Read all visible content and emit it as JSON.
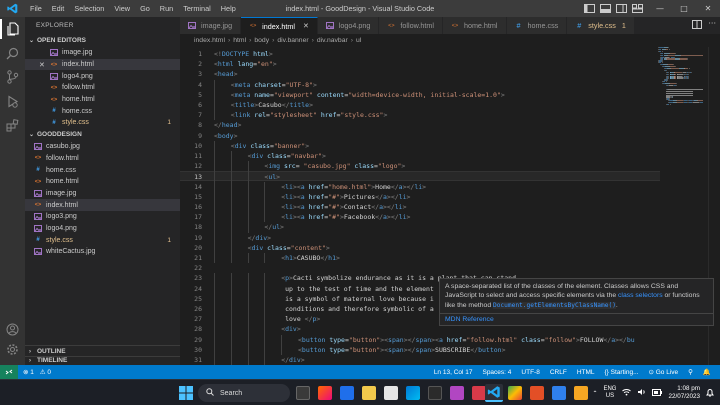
{
  "window": {
    "title": "index.html - GoodDesign - Visual Studio Code",
    "menu": [
      "File",
      "Edit",
      "Selection",
      "View",
      "Go",
      "Run",
      "Terminal",
      "Help"
    ]
  },
  "activity_bar": {
    "icons": [
      "explorer-icon",
      "search-icon",
      "source-control-icon",
      "run-debug-icon",
      "extensions-icon",
      "account-icon",
      "manage-gear-icon"
    ]
  },
  "sidebar": {
    "title": "EXPLORER",
    "open_editors": {
      "label": "OPEN EDITORS",
      "files": [
        {
          "name": "image.jpg",
          "icon": "image"
        },
        {
          "name": "index.html",
          "icon": "html",
          "close": "✕",
          "selected": true
        },
        {
          "name": "logo4.png",
          "icon": "image"
        },
        {
          "name": "follow.html",
          "icon": "html"
        },
        {
          "name": "home.html",
          "icon": "html"
        },
        {
          "name": "home.css",
          "icon": "css"
        },
        {
          "name": "style.css",
          "icon": "css",
          "modified": true,
          "count": "1"
        }
      ]
    },
    "folder": {
      "label": "GOODDESIGN",
      "files": [
        {
          "name": "casubo.jpg",
          "icon": "image"
        },
        {
          "name": "follow.html",
          "icon": "html"
        },
        {
          "name": "home.css",
          "icon": "css"
        },
        {
          "name": "home.html",
          "icon": "html"
        },
        {
          "name": "image.jpg",
          "icon": "image"
        },
        {
          "name": "index.html",
          "icon": "html",
          "selected": true
        },
        {
          "name": "logo3.png",
          "icon": "image"
        },
        {
          "name": "logo4.png",
          "icon": "image"
        },
        {
          "name": "style.css",
          "icon": "css",
          "modified": true,
          "count": "1"
        },
        {
          "name": "whiteCactus.jpg",
          "icon": "image"
        }
      ]
    },
    "outline_label": "OUTLINE",
    "timeline_label": "TIMELINE"
  },
  "tabs": [
    {
      "label": "image.jpg",
      "icon": "image"
    },
    {
      "label": "index.html",
      "icon": "html",
      "active": true,
      "close": "✕"
    },
    {
      "label": "logo4.png",
      "icon": "image"
    },
    {
      "label": "follow.html",
      "icon": "html"
    },
    {
      "label": "home.html",
      "icon": "html"
    },
    {
      "label": "home.css",
      "icon": "css"
    },
    {
      "label": "style.css",
      "icon": "css",
      "modified": true,
      "count": "1"
    }
  ],
  "breadcrumb": [
    "index.html",
    "html",
    "body",
    "div.banner",
    "div.navbar",
    "ul"
  ],
  "code": {
    "current_line": 13,
    "lines": [
      {
        "n": "1",
        "indent": 0,
        "t": [
          [
            "p",
            "<!"
          ],
          [
            "g",
            "DOCTYPE"
          ],
          [
            "a",
            " html"
          ],
          [
            "p",
            ">"
          ]
        ]
      },
      {
        "n": "2",
        "indent": 0,
        "t": [
          [
            "p",
            "<"
          ],
          [
            "g",
            "html"
          ],
          [
            "a",
            " lang"
          ],
          [
            "x",
            "="
          ],
          [
            "s",
            "\"en\""
          ],
          [
            "p",
            ">"
          ]
        ]
      },
      {
        "n": "3",
        "indent": 0,
        "t": [
          [
            "p",
            "<"
          ],
          [
            "g",
            "head"
          ],
          [
            "p",
            ">"
          ]
        ]
      },
      {
        "n": "4",
        "indent": 1,
        "t": [
          [
            "p",
            "<"
          ],
          [
            "g",
            "meta"
          ],
          [
            "a",
            " charset"
          ],
          [
            "x",
            "="
          ],
          [
            "s",
            "\"UTF-8\""
          ],
          [
            "p",
            ">"
          ]
        ]
      },
      {
        "n": "5",
        "indent": 1,
        "t": [
          [
            "p",
            "<"
          ],
          [
            "g",
            "meta"
          ],
          [
            "a",
            " name"
          ],
          [
            "x",
            "="
          ],
          [
            "s",
            "\"viewport\""
          ],
          [
            "a",
            " content"
          ],
          [
            "x",
            "="
          ],
          [
            "s",
            "\"width=device-width, initial-scale=1.0\""
          ],
          [
            "p",
            ">"
          ]
        ]
      },
      {
        "n": "6",
        "indent": 1,
        "t": [
          [
            "p",
            "<"
          ],
          [
            "g",
            "title"
          ],
          [
            "p",
            ">"
          ],
          [
            "x",
            "Casubo"
          ],
          [
            "p",
            "</"
          ],
          [
            "g",
            "title"
          ],
          [
            "p",
            ">"
          ]
        ]
      },
      {
        "n": "7",
        "indent": 1,
        "t": [
          [
            "p",
            "<"
          ],
          [
            "g",
            "link"
          ],
          [
            "a",
            " rel"
          ],
          [
            "x",
            "="
          ],
          [
            "s",
            "\"stylesheet\""
          ],
          [
            "a",
            " href"
          ],
          [
            "x",
            "="
          ],
          [
            "s",
            "\"style.css\""
          ],
          [
            "p",
            ">"
          ]
        ]
      },
      {
        "n": "8",
        "indent": 0,
        "t": [
          [
            "p",
            "</"
          ],
          [
            "g",
            "head"
          ],
          [
            "p",
            ">"
          ]
        ]
      },
      {
        "n": "9",
        "indent": 0,
        "t": [
          [
            "p",
            "<"
          ],
          [
            "g",
            "body"
          ],
          [
            "p",
            ">"
          ]
        ]
      },
      {
        "n": "10",
        "indent": 1,
        "t": [
          [
            "p",
            "<"
          ],
          [
            "g",
            "div"
          ],
          [
            "a",
            " class"
          ],
          [
            "x",
            "="
          ],
          [
            "s",
            "\"banner\""
          ],
          [
            "p",
            ">"
          ]
        ]
      },
      {
        "n": "11",
        "indent": 2,
        "t": [
          [
            "p",
            "<"
          ],
          [
            "g",
            "div"
          ],
          [
            "a",
            " class"
          ],
          [
            "x",
            "="
          ],
          [
            "s",
            "\"navbar\""
          ],
          [
            "p",
            ">"
          ]
        ]
      },
      {
        "n": "12",
        "indent": 3,
        "t": [
          [
            "p",
            "<"
          ],
          [
            "g",
            "img"
          ],
          [
            "a",
            " src"
          ],
          [
            "x",
            "= "
          ],
          [
            "s",
            "\"casubo.jpg\""
          ],
          [
            "a",
            " class"
          ],
          [
            "x",
            "="
          ],
          [
            "s",
            "\"logo\""
          ],
          [
            "p",
            ">"
          ]
        ]
      },
      {
        "n": "13",
        "indent": 3,
        "t": [
          [
            "p",
            "<"
          ],
          [
            "g",
            "ul"
          ],
          [
            "p",
            ">"
          ]
        ]
      },
      {
        "n": "14",
        "indent": 4,
        "t": [
          [
            "p",
            "<"
          ],
          [
            "g",
            "li"
          ],
          [
            "p",
            "><"
          ],
          [
            "g",
            "a"
          ],
          [
            "a",
            " href"
          ],
          [
            "x",
            "="
          ],
          [
            "s",
            "\"home.html\""
          ],
          [
            "p",
            ">"
          ],
          [
            "x",
            "Home"
          ],
          [
            "p",
            "</"
          ],
          [
            "g",
            "a"
          ],
          [
            "p",
            "></"
          ],
          [
            "g",
            "li"
          ],
          [
            "p",
            ">"
          ]
        ]
      },
      {
        "n": "15",
        "indent": 4,
        "t": [
          [
            "p",
            "<"
          ],
          [
            "g",
            "li"
          ],
          [
            "p",
            "><"
          ],
          [
            "g",
            "a"
          ],
          [
            "a",
            " href"
          ],
          [
            "x",
            "="
          ],
          [
            "s",
            "\"#\""
          ],
          [
            "p",
            ">"
          ],
          [
            "x",
            "Pictures"
          ],
          [
            "p",
            "</"
          ],
          [
            "g",
            "a"
          ],
          [
            "p",
            "></"
          ],
          [
            "g",
            "li"
          ],
          [
            "p",
            ">"
          ]
        ]
      },
      {
        "n": "16",
        "indent": 4,
        "t": [
          [
            "p",
            "<"
          ],
          [
            "g",
            "li"
          ],
          [
            "p",
            "><"
          ],
          [
            "g",
            "a"
          ],
          [
            "a",
            " href"
          ],
          [
            "x",
            "="
          ],
          [
            "s",
            "\"#\""
          ],
          [
            "p",
            ">"
          ],
          [
            "x",
            "Contact"
          ],
          [
            "p",
            "</"
          ],
          [
            "g",
            "a"
          ],
          [
            "p",
            "></"
          ],
          [
            "g",
            "li"
          ],
          [
            "p",
            ">"
          ]
        ]
      },
      {
        "n": "17",
        "indent": 4,
        "t": [
          [
            "p",
            "<"
          ],
          [
            "g",
            "li"
          ],
          [
            "p",
            "><"
          ],
          [
            "g",
            "a"
          ],
          [
            "a",
            " href"
          ],
          [
            "x",
            "="
          ],
          [
            "s",
            "\"#\""
          ],
          [
            "p",
            ">"
          ],
          [
            "x",
            "Facebook"
          ],
          [
            "p",
            "</"
          ],
          [
            "g",
            "a"
          ],
          [
            "p",
            "></"
          ],
          [
            "g",
            "li"
          ],
          [
            "p",
            ">"
          ]
        ]
      },
      {
        "n": "18",
        "indent": 3,
        "t": [
          [
            "p",
            "</"
          ],
          [
            "g",
            "ul"
          ],
          [
            "p",
            ">"
          ]
        ]
      },
      {
        "n": "19",
        "indent": 2,
        "t": [
          [
            "p",
            "</"
          ],
          [
            "g",
            "div"
          ],
          [
            "p",
            ">"
          ]
        ]
      },
      {
        "n": "20",
        "indent": 2,
        "t": [
          [
            "p",
            "<"
          ],
          [
            "g",
            "div"
          ],
          [
            "a",
            " class"
          ],
          [
            "x",
            "="
          ],
          [
            "s",
            "\"content\""
          ],
          [
            "p",
            ">"
          ]
        ]
      },
      {
        "n": "21",
        "indent": 4,
        "t": [
          [
            "p",
            "<"
          ],
          [
            "g",
            "h1"
          ],
          [
            "p",
            ">"
          ],
          [
            "x",
            "CASUBO"
          ],
          [
            "p",
            "</"
          ],
          [
            "g",
            "h1"
          ],
          [
            "p",
            ">"
          ]
        ]
      },
      {
        "n": "22",
        "indent": 0,
        "t": []
      },
      {
        "n": "23",
        "indent": 4,
        "t": [
          [
            "p",
            "<"
          ],
          [
            "g",
            "p"
          ],
          [
            "p",
            ">"
          ],
          [
            "x",
            "Cacti symbolize endurance as it is a plant that can stand"
          ]
        ]
      },
      {
        "n": "24",
        "indent": 4,
        "t": [
          [
            "x",
            " up to the test of time and the element"
          ]
        ]
      },
      {
        "n": "25",
        "indent": 4,
        "t": [
          [
            "x",
            " is a symbol of maternal love because i"
          ]
        ]
      },
      {
        "n": "26",
        "indent": 4,
        "t": [
          [
            "x",
            " conditions and therefore symbolic of a"
          ]
        ]
      },
      {
        "n": "27",
        "indent": 4,
        "t": [
          [
            "x",
            " love "
          ],
          [
            "p",
            "</"
          ],
          [
            "g",
            "p"
          ],
          [
            "p",
            ">"
          ]
        ]
      },
      {
        "n": "28",
        "indent": 4,
        "t": [
          [
            "p",
            "<"
          ],
          [
            "g",
            "div"
          ],
          [
            "p",
            ">"
          ]
        ]
      },
      {
        "n": "29",
        "indent": 5,
        "t": [
          [
            "p",
            "<"
          ],
          [
            "g",
            "button"
          ],
          [
            "a",
            " type"
          ],
          [
            "x",
            "="
          ],
          [
            "s",
            "\"button\""
          ],
          [
            "p",
            "><"
          ],
          [
            "g",
            "span"
          ],
          [
            "p",
            "></"
          ],
          [
            "g",
            "span"
          ],
          [
            "p",
            "><"
          ],
          [
            "g",
            "a"
          ],
          [
            "a",
            " href"
          ],
          [
            "x",
            "="
          ],
          [
            "s",
            "\"follow.html\""
          ],
          [
            "a",
            " class"
          ],
          [
            "x",
            "="
          ],
          [
            "s",
            "\"follow\""
          ],
          [
            "p",
            ">"
          ],
          [
            "x",
            "FOLLOW"
          ],
          [
            "p",
            "</"
          ],
          [
            "g",
            "a"
          ],
          [
            "p",
            "></"
          ],
          [
            "g",
            "bu"
          ]
        ]
      },
      {
        "n": "30",
        "indent": 5,
        "t": [
          [
            "p",
            "<"
          ],
          [
            "g",
            "button"
          ],
          [
            "a",
            " type"
          ],
          [
            "x",
            "="
          ],
          [
            "s",
            "\"button\""
          ],
          [
            "p",
            "><"
          ],
          [
            "g",
            "span"
          ],
          [
            "p",
            "></"
          ],
          [
            "g",
            "span"
          ],
          [
            "p",
            ">"
          ],
          [
            "x",
            "SUBSCRIBE"
          ],
          [
            "p",
            "</"
          ],
          [
            "g",
            "button"
          ],
          [
            "p",
            ">"
          ]
        ]
      },
      {
        "n": "31",
        "indent": 4,
        "t": [
          [
            "p",
            "</"
          ],
          [
            "g",
            "div"
          ],
          [
            "p",
            ">"
          ]
        ]
      }
    ]
  },
  "hover": {
    "text_before": "A space-separated list of the classes of the element. Classes allows CSS and JavaScript to select and access specific elements via the ",
    "link1": "class selectors",
    "text_mid": " or functions like the method ",
    "code": "Document.getElementsByClassName()",
    "text_after": ".",
    "ref": "MDN Reference"
  },
  "status": {
    "remote_icon": "remote-icon",
    "errors": "⊗ 1",
    "warnings": "⚠ 0",
    "right": [
      "Ln 13, Col 17",
      "Spaces: 4",
      "UTF-8",
      "CRLF",
      "HTML",
      "{} Starting...",
      "⊙ Go Live",
      "⚲",
      "🔔"
    ]
  },
  "taskbar": {
    "search": "Search",
    "lang_top": "ENG",
    "lang_bottom": "US",
    "time": "1:08 pm",
    "date": "22/07/2023"
  },
  "colors": {
    "accent": "#007acc",
    "tag": "#569cd6",
    "attr": "#9cdcfe",
    "string": "#ce9178",
    "modified": "#e2c08d"
  }
}
